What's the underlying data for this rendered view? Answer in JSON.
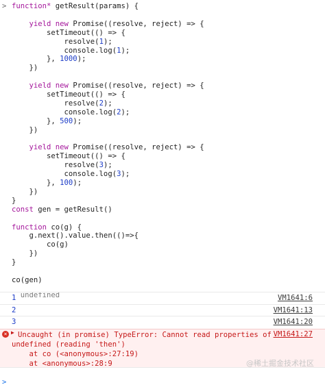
{
  "console": {
    "input_prompt": ">",
    "code_lines": [
      "function* getResult(params) {",
      "",
      "    yield new Promise((resolve, reject) => {",
      "        setTimeout(() => {",
      "            resolve(1);",
      "            console.log(1);",
      "        }, 1000);",
      "    })",
      "",
      "    yield new Promise((resolve, reject) => {",
      "        setTimeout(() => {",
      "            resolve(2);",
      "            console.log(2);",
      "        }, 500);",
      "    })",
      "",
      "    yield new Promise((resolve, reject) => {",
      "        setTimeout(() => {",
      "            resolve(3);",
      "            console.log(3);",
      "        }, 100);",
      "    })",
      "}",
      "const gen = getResult()",
      "",
      "function co(g) {",
      "    g.next().value.then(()=>{",
      "        co(g)",
      "    })",
      "}",
      "",
      "co(gen)"
    ],
    "return_value": "undefined",
    "logs": [
      {
        "value": "1",
        "source": "VM1641:6"
      },
      {
        "value": "2",
        "source": "VM1641:13"
      },
      {
        "value": "3",
        "source": "VM1641:20"
      }
    ],
    "error": {
      "icon": "×",
      "expand_arrow": "▶",
      "message_line1": "Uncaught (in promise) TypeError: Cannot read properties of",
      "message_line2": "undefined (reading 'then')",
      "stack": [
        "    at co (<anonymous>:27:19)",
        "    at <anonymous>:28:9"
      ],
      "source": "VM1641:27"
    },
    "empty_prompt": ">"
  },
  "watermark": "@稀土掘金技术社区"
}
